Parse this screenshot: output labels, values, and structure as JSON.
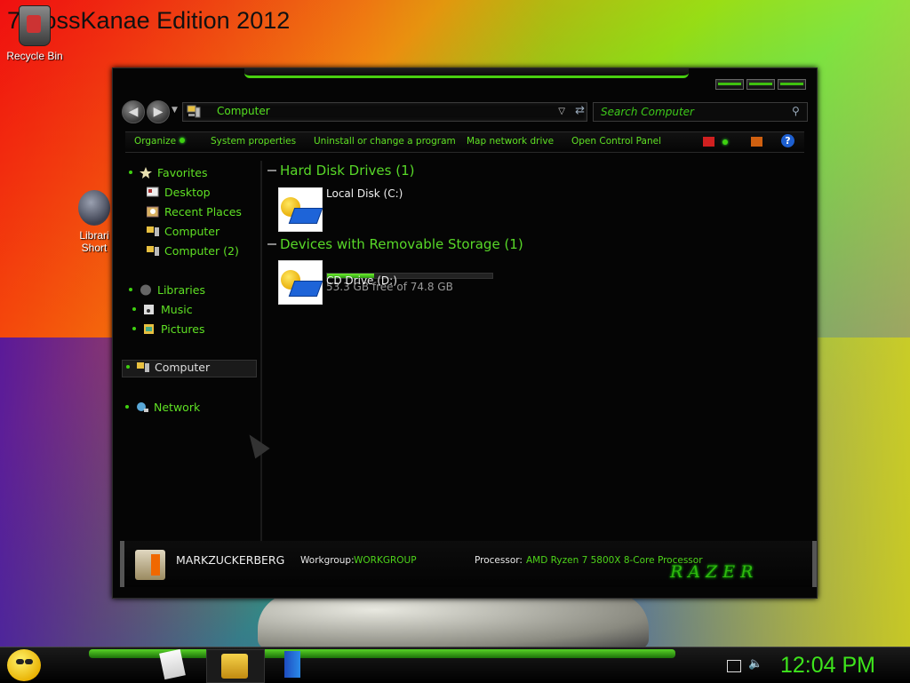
{
  "desktop": {
    "title": "7 BossKanae Edition 2012",
    "icons": [
      {
        "label": "Recycle Bin"
      },
      {
        "label": "Librari Short"
      }
    ]
  },
  "window": {
    "address": "Computer",
    "search_placeholder": "Search Computer",
    "toolbar": {
      "organize": "Organize",
      "system_properties": "System properties",
      "uninstall": "Uninstall or change a program",
      "map_drive": "Map network drive",
      "control_panel": "Open Control Panel",
      "help": "?"
    },
    "nav": {
      "favorites": "Favorites",
      "desktop": "Desktop",
      "recent_places": "Recent Places",
      "computer": "Computer",
      "computer2": "Computer (2)",
      "libraries": "Libraries",
      "music": "Music",
      "pictures": "Pictures",
      "computer_selected": "Computer",
      "network": "Network"
    },
    "groups": {
      "hdd": "Hard Disk Drives (1)",
      "removable": "Devices with Removable Storage (1)"
    },
    "drives": {
      "local_name": "Local Disk (C:)",
      "local_free": "53.3 GB free of 74.8 GB",
      "local_used_fraction": 0.287,
      "cd_name": "CD Drive (D:)"
    },
    "details": {
      "computer_name": "MARKZUCKERBERG",
      "workgroup_label": "Workgroup:",
      "workgroup_value": "WORKGROUP",
      "processor_label": "Processor:",
      "processor_value": "AMD Ryzen 7 5800X 8-Core Processor",
      "brand": "RAZER"
    }
  },
  "taskbar": {
    "clock": "12:04 PM"
  },
  "colors": {
    "accent_green": "#4ed41a",
    "window_bg": "#050505"
  },
  "icons": {
    "start": "smiley-start-icon",
    "search": "magnifier-icon",
    "help": "help-icon"
  }
}
